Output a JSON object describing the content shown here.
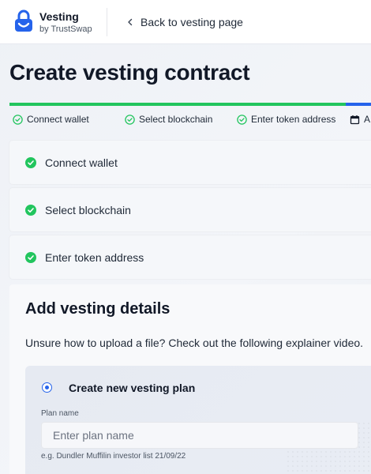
{
  "header": {
    "brand_name": "Vesting",
    "brand_sub": "by TrustSwap",
    "back_label": "Back to vesting page"
  },
  "page": {
    "title": "Create vesting contract"
  },
  "progress": {
    "steps": [
      {
        "label": "Connect wallet",
        "state": "done"
      },
      {
        "label": "Select blockchain",
        "state": "done"
      },
      {
        "label": "Enter token address",
        "state": "done"
      },
      {
        "label": "A",
        "state": "current"
      }
    ]
  },
  "completed_cards": [
    {
      "label": "Connect wallet"
    },
    {
      "label": "Select blockchain"
    },
    {
      "label": "Enter token address"
    }
  ],
  "details": {
    "title": "Add vesting details",
    "help_text": "Unsure how to upload a file? Check out the following explainer video.",
    "option_label": "Create new vesting plan",
    "plan_name_label": "Plan name",
    "plan_name_placeholder": "Enter plan name",
    "plan_name_value": "",
    "plan_name_hint": "e.g. Dundler Muffilin investor list 21/09/22"
  },
  "colors": {
    "accent": "#2563eb",
    "success": "#22c55e"
  }
}
